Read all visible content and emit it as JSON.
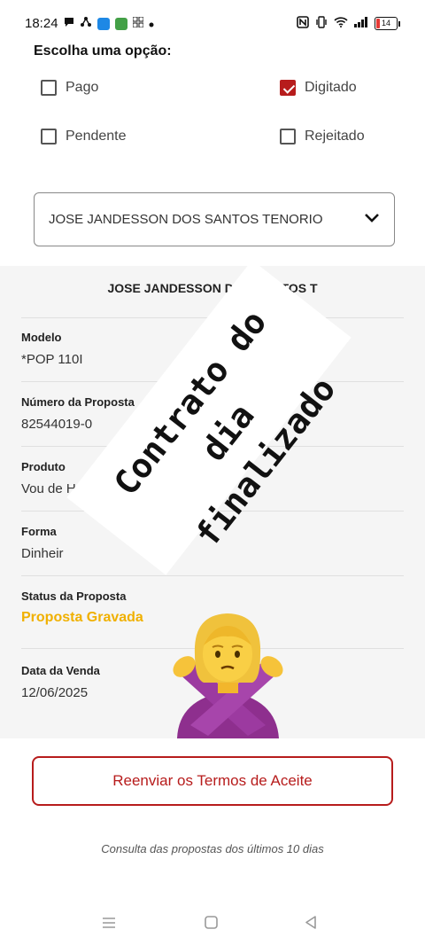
{
  "status_bar": {
    "time": "18:24",
    "battery": "14",
    "colors": {
      "battery_low": "#e53935"
    }
  },
  "filter": {
    "title": "Escolha uma opção:",
    "options": [
      {
        "label": "Pago",
        "checked": false
      },
      {
        "label": "Digitado",
        "checked": true
      },
      {
        "label": "Pendente",
        "checked": false
      },
      {
        "label": "Rejeitado",
        "checked": false
      }
    ]
  },
  "client_select": {
    "value": "JOSE JANDESSON DOS SANTOS TENORIO"
  },
  "proposal_card": {
    "client_name": "JOSE JANDESSON DOS SANTOS T",
    "fields": [
      {
        "label": "Modelo",
        "value": "*POP 110I"
      },
      {
        "label": "Número da Proposta",
        "value": "82544019-0"
      },
      {
        "label": "Produto",
        "value": "Vou de Hor"
      },
      {
        "label": "Forma",
        "value": "Dinheir"
      },
      {
        "label": "Status da Proposta",
        "value": "Proposta Gravada"
      },
      {
        "label": "Data da Venda",
        "value": "12/06/2025"
      }
    ]
  },
  "overlay": {
    "line1": "Contrato do dia",
    "line2": "finalizado",
    "emoji": "person-gesturing-no"
  },
  "resend_button": {
    "label": "Reenviar os Termos de Aceite"
  },
  "footnote": "Consulta das propostas dos últimos 10 dias",
  "colors": {
    "accent": "#b71c1c",
    "status": "#f0b000"
  }
}
